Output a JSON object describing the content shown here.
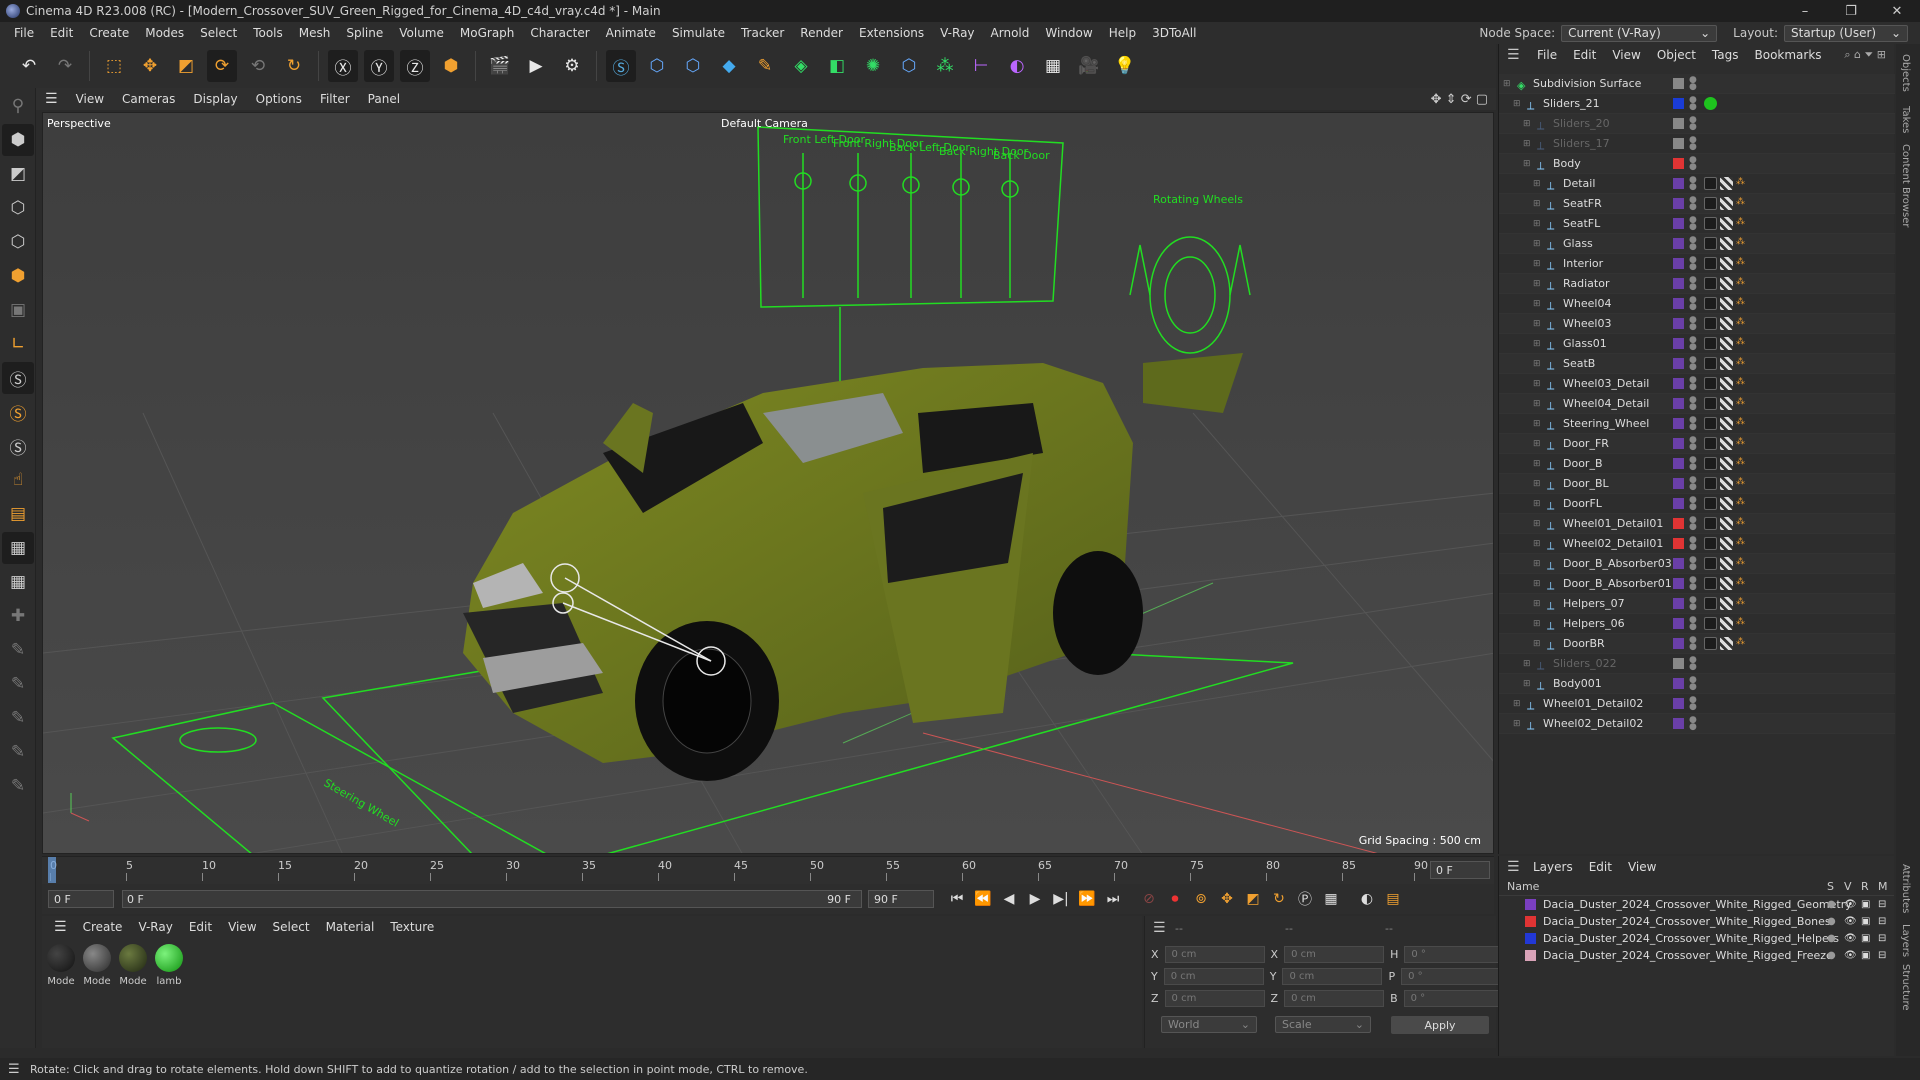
{
  "window": {
    "title": "Cinema 4D R23.008 (RC) - [Modern_Crossover_SUV_Green_Rigged_for_Cinema_4D_c4d_vray.c4d *] - Main",
    "minimize": "–",
    "maximize": "❐",
    "close": "✕"
  },
  "menu": [
    "File",
    "Edit",
    "Create",
    "Modes",
    "Select",
    "Tools",
    "Mesh",
    "Spline",
    "Volume",
    "MoGraph",
    "Character",
    "Animate",
    "Simulate",
    "Tracker",
    "Render",
    "Extensions",
    "V-Ray",
    "Arnold",
    "Window",
    "Help",
    "3DToAll"
  ],
  "nodespace": {
    "label": "Node Space:",
    "value": "Current (V-Ray)",
    "layout_label": "Layout:",
    "layout_value": "Startup (User)"
  },
  "viewport_menu": [
    "View",
    "Cameras",
    "Display",
    "Options",
    "Filter",
    "Panel"
  ],
  "viewport": {
    "label": "Perspective",
    "camera": "Default Camera",
    "grid_spacing": "Grid Spacing : 500 cm",
    "rig_labels": [
      "Front Left Door",
      "Front Right Door",
      "Back Left Door",
      "Back Right Door",
      "Back Door"
    ],
    "rotating_label": "Rotating Wheels",
    "steering_label": "Steering Wheel"
  },
  "timeline": {
    "ticks": [
      "0",
      "5",
      "10",
      "15",
      "20",
      "25",
      "30",
      "35",
      "40",
      "45",
      "50",
      "55",
      "60",
      "65",
      "70",
      "75",
      "80",
      "85",
      "90"
    ],
    "end_frame": "0 F"
  },
  "playbar": {
    "start": "0 F",
    "current": "0 F",
    "end": "90 F",
    "end2": "90 F"
  },
  "material_menu": [
    "Create",
    "V-Ray",
    "Edit",
    "View",
    "Select",
    "Material",
    "Texture"
  ],
  "materials": [
    {
      "name": "Mode",
      "color": "#111111"
    },
    {
      "name": "Mode",
      "color": "#2a2a2a"
    },
    {
      "name": "Mode",
      "color": "#2f3a1d"
    },
    {
      "name": "lamb",
      "color": "#1ec31e"
    }
  ],
  "coords": {
    "header1": "--",
    "header2": "--",
    "header3": "--",
    "rows": [
      {
        "a": "X",
        "v1": "0 cm",
        "b": "X",
        "v2": "0 cm",
        "c": "H",
        "v3": "0 °"
      },
      {
        "a": "Y",
        "v1": "0 cm",
        "b": "Y",
        "v2": "0 cm",
        "c": "P",
        "v3": "0 °"
      },
      {
        "a": "Z",
        "v1": "0 cm",
        "b": "Z",
        "v2": "0 cm",
        "c": "B",
        "v3": "0 °"
      }
    ],
    "mode1": "World",
    "mode2": "Scale",
    "apply": "Apply"
  },
  "object_menu": [
    "File",
    "Edit",
    "View",
    "Object",
    "Tags",
    "Bookmarks"
  ],
  "objects": [
    {
      "name": "Subdivision Surface",
      "indent": 0,
      "color": "#888888",
      "dim": false
    },
    {
      "name": "Sliders_21",
      "indent": 1,
      "color": "#1a3cd6",
      "dim": false
    },
    {
      "name": "Sliders_20",
      "indent": 2,
      "color": "#888888",
      "dim": true
    },
    {
      "name": "Sliders_17",
      "indent": 2,
      "color": "#888888",
      "dim": true
    },
    {
      "name": "Body",
      "indent": 2,
      "color": "#e03434",
      "dim": false
    },
    {
      "name": "Detail",
      "indent": 3,
      "color": "#6a3fa8",
      "dim": false
    },
    {
      "name": "SeatFR",
      "indent": 3,
      "color": "#6a3fa8",
      "dim": false
    },
    {
      "name": "SeatFL",
      "indent": 3,
      "color": "#6a3fa8",
      "dim": false
    },
    {
      "name": "Glass",
      "indent": 3,
      "color": "#6a3fa8",
      "dim": false
    },
    {
      "name": "Interior",
      "indent": 3,
      "color": "#6a3fa8",
      "dim": false
    },
    {
      "name": "Radiator",
      "indent": 3,
      "color": "#6a3fa8",
      "dim": false
    },
    {
      "name": "Wheel04",
      "indent": 3,
      "color": "#6a3fa8",
      "dim": false
    },
    {
      "name": "Wheel03",
      "indent": 3,
      "color": "#6a3fa8",
      "dim": false
    },
    {
      "name": "Glass01",
      "indent": 3,
      "color": "#6a3fa8",
      "dim": false
    },
    {
      "name": "SeatB",
      "indent": 3,
      "color": "#6a3fa8",
      "dim": false
    },
    {
      "name": "Wheel03_Detail",
      "indent": 3,
      "color": "#6a3fa8",
      "dim": false
    },
    {
      "name": "Wheel04_Detail",
      "indent": 3,
      "color": "#6a3fa8",
      "dim": false
    },
    {
      "name": "Steering_Wheel",
      "indent": 3,
      "color": "#6a3fa8",
      "dim": false
    },
    {
      "name": "Door_FR",
      "indent": 3,
      "color": "#6a3fa8",
      "dim": false
    },
    {
      "name": "Door_B",
      "indent": 3,
      "color": "#6a3fa8",
      "dim": false
    },
    {
      "name": "Door_BL",
      "indent": 3,
      "color": "#6a3fa8",
      "dim": false
    },
    {
      "name": "DoorFL",
      "indent": 3,
      "color": "#6a3fa8",
      "dim": false
    },
    {
      "name": "Wheel01_Detail01",
      "indent": 3,
      "color": "#e03434",
      "dim": false
    },
    {
      "name": "Wheel02_Detail01",
      "indent": 3,
      "color": "#e03434",
      "dim": false
    },
    {
      "name": "Door_B_Absorber03",
      "indent": 3,
      "color": "#6a3fa8",
      "dim": false
    },
    {
      "name": "Door_B_Absorber01",
      "indent": 3,
      "color": "#6a3fa8",
      "dim": false
    },
    {
      "name": "Helpers_07",
      "indent": 3,
      "color": "#6a3fa8",
      "dim": false
    },
    {
      "name": "Helpers_06",
      "indent": 3,
      "color": "#6a3fa8",
      "dim": false
    },
    {
      "name": "DoorBR",
      "indent": 3,
      "color": "#6a3fa8",
      "dim": false
    },
    {
      "name": "Sliders_022",
      "indent": 2,
      "color": "#888888",
      "dim": true
    },
    {
      "name": "Body001",
      "indent": 2,
      "color": "#6a3fa8",
      "dim": false
    },
    {
      "name": "Wheel01_Detail02",
      "indent": 1,
      "color": "#6a3fa8",
      "dim": false
    },
    {
      "name": "Wheel02_Detail02",
      "indent": 1,
      "color": "#6a3fa8",
      "dim": false
    }
  ],
  "layers_menu": [
    "Layers",
    "Edit",
    "View"
  ],
  "layers_cols": {
    "name": "Name",
    "s": "S",
    "v": "V",
    "r": "R",
    "m": "M"
  },
  "layers": [
    {
      "name": "Dacia_Duster_2024_Crossover_White_Rigged_Geometry",
      "color": "#7a3fc0"
    },
    {
      "name": "Dacia_Duster_2024_Crossover_White_Rigged_Bones",
      "color": "#e03434"
    },
    {
      "name": "Dacia_Duster_2024_Crossover_White_Rigged_Helpers",
      "color": "#2238d6"
    },
    {
      "name": "Dacia_Duster_2024_Crossover_White_Rigged_Freeze",
      "color": "#d9a3b8"
    }
  ],
  "side_tabs": [
    "Objects",
    "Takes",
    "Content Browser",
    "Attributes",
    "Layers",
    "Structure"
  ],
  "status": "Rotate: Click and drag to rotate elements. Hold down SHIFT to add to quantize rotation / add to the selection in point mode, CTRL to remove."
}
